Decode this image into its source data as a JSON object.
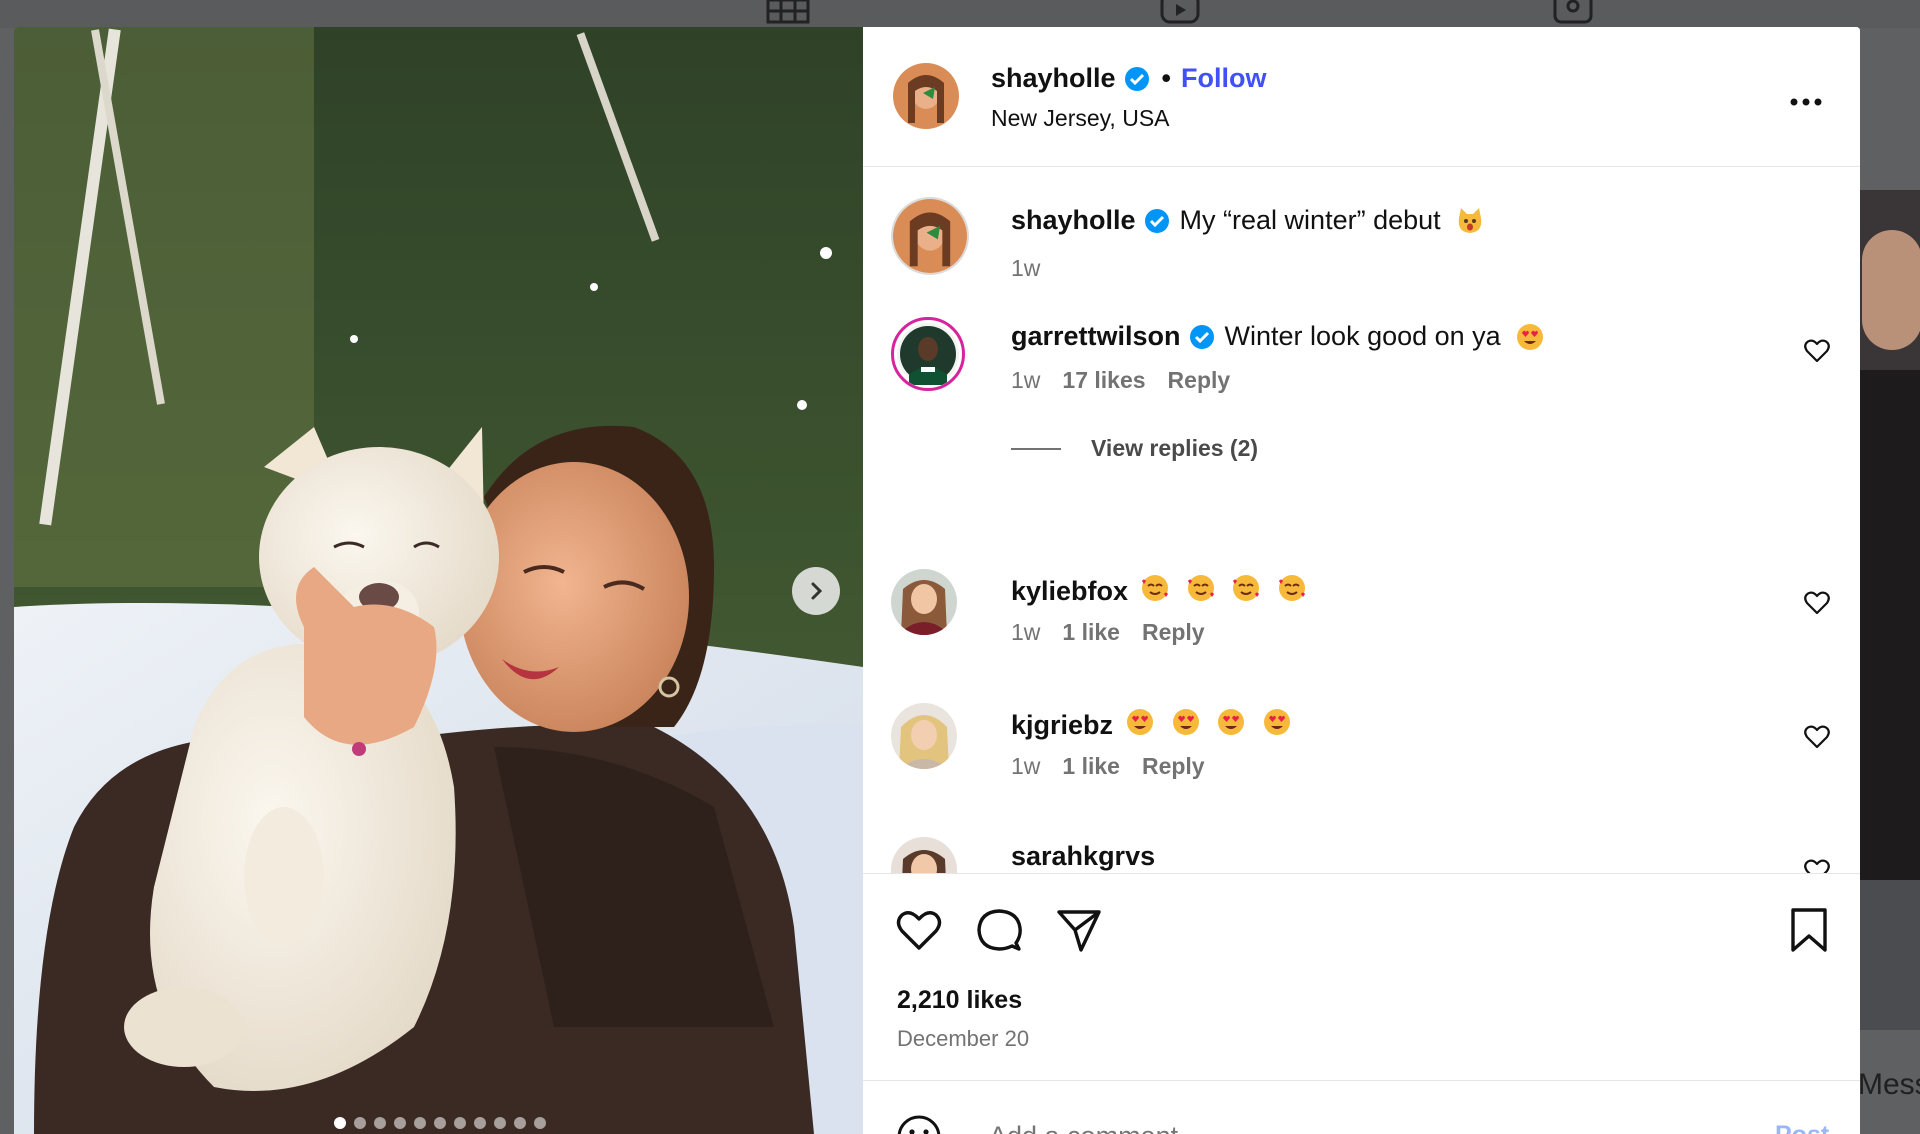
{
  "post": {
    "username": "shayholle",
    "separator": "•",
    "follow_label": "Follow",
    "location": "New Jersey, USA",
    "more_icon": "more-options-icon",
    "caption": {
      "username": "shayholle",
      "text": "My “real winter” debut",
      "emoji": "cat-emoji",
      "time": "1w"
    },
    "likes": "2,210 likes",
    "date": "December 20",
    "carousel": {
      "slide_count": 11,
      "active_index": 0
    }
  },
  "comments": [
    {
      "username": "garrettwilson",
      "verified": true,
      "text": "Winter look good on ya",
      "emojis": [
        "heart-eyes-emoji"
      ],
      "time": "1w",
      "likes": "17 likes",
      "reply_label": "Reply",
      "view_replies": "View replies (2)"
    },
    {
      "username": "kyliebfox",
      "verified": false,
      "text": "",
      "emojis": [
        "smiling-hearts-emoji",
        "smiling-hearts-emoji",
        "smiling-hearts-emoji",
        "smiling-hearts-emoji"
      ],
      "time": "1w",
      "likes": "1 like",
      "reply_label": "Reply"
    },
    {
      "username": "kjgriebz",
      "verified": false,
      "text": "",
      "emojis": [
        "heart-eyes-emoji",
        "heart-eyes-emoji",
        "heart-eyes-emoji",
        "heart-eyes-emoji"
      ],
      "time": "1w",
      "likes": "1 like",
      "reply_label": "Reply"
    },
    {
      "username": "sarahkgrvs",
      "verified": false,
      "text": "",
      "emojis": []
    }
  ],
  "comment_box": {
    "placeholder": "Add a comment...",
    "post_label": "Post"
  },
  "background": {
    "side_text": "Mess"
  },
  "colors": {
    "follow": "#4150f7",
    "verified": "#0095f6",
    "post_button": "#9bb6f6"
  }
}
